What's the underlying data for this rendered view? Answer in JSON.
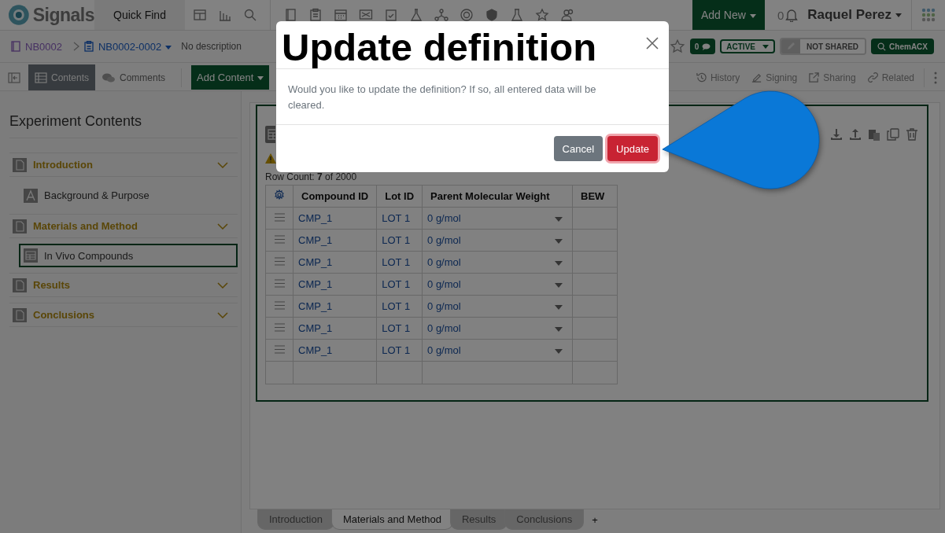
{
  "top_nav": {
    "logo": "Signals",
    "quick_find": "Quick Find",
    "add_new": "Add New",
    "notifications": "0",
    "user": "Raquel Perez"
  },
  "breadcrumb": {
    "notebook": "NB0002",
    "experiment": "NB0002-0002",
    "description": "No description",
    "comments": "0",
    "status": "ACTIVE",
    "sharing": "NOT SHARED",
    "search_button": "ChemACX"
  },
  "toolbar": {
    "views": [
      {
        "label": "Contents",
        "kind": "contents",
        "selected": true
      },
      {
        "label": "Comments",
        "kind": "comments",
        "selected": false
      }
    ],
    "add_content": "Add Content",
    "actions": [
      {
        "label": "History",
        "kind": "history"
      },
      {
        "label": "Signing",
        "kind": "signing"
      },
      {
        "label": "Sharing",
        "kind": "sharing"
      },
      {
        "label": "Related",
        "kind": "related"
      }
    ]
  },
  "sidebar": {
    "title": "Experiment Contents",
    "sections": [
      {
        "title": "Introduction",
        "children": [
          {
            "label": "Background & Purpose",
            "kind": "text",
            "selected": false
          }
        ]
      },
      {
        "title": "Materials and Method",
        "children": [
          {
            "label": "In Vivo Compounds",
            "kind": "table",
            "selected": true
          }
        ]
      },
      {
        "title": "Results"
      },
      {
        "title": "Conclusions"
      }
    ]
  },
  "table": {
    "row_count": "Row Count: **7** of 2000",
    "columns": [
      "Compound ID",
      "Lot ID",
      "Parent Molecular Weight",
      "BEW"
    ],
    "rows": [
      {
        "compound_id": "CMP_1",
        "lot_id": "LOT 1",
        "weight": "0 g/mol"
      },
      {
        "compound_id": "CMP_1",
        "lot_id": "LOT 1",
        "weight": "0 g/mol"
      },
      {
        "compound_id": "CMP_1",
        "lot_id": "LOT 1",
        "weight": "0 g/mol"
      },
      {
        "compound_id": "CMP_1",
        "lot_id": "LOT 1",
        "weight": "0 g/mol"
      },
      {
        "compound_id": "CMP_1",
        "lot_id": "LOT 1",
        "weight": "0 g/mol"
      },
      {
        "compound_id": "CMP_1",
        "lot_id": "LOT 1",
        "weight": "0 g/mol"
      },
      {
        "compound_id": "CMP_1",
        "lot_id": "LOT 1",
        "weight": "0 g/mol"
      }
    ]
  },
  "sheet_tabs": [
    {
      "label": "Introduction",
      "selected": false
    },
    {
      "label": "Materials and Method",
      "selected": true
    },
    {
      "label": "Results",
      "selected": false
    },
    {
      "label": "Conclusions",
      "selected": false
    }
  ],
  "add_tab": "+",
  "dialog": {
    "title": "Update definition",
    "message": "Would you like to update the definition? If so, all entered data will be cleared.",
    "buttons": [
      {
        "label": "Cancel",
        "kind": "secondary"
      },
      {
        "label": "Update",
        "kind": "danger"
      }
    ]
  }
}
